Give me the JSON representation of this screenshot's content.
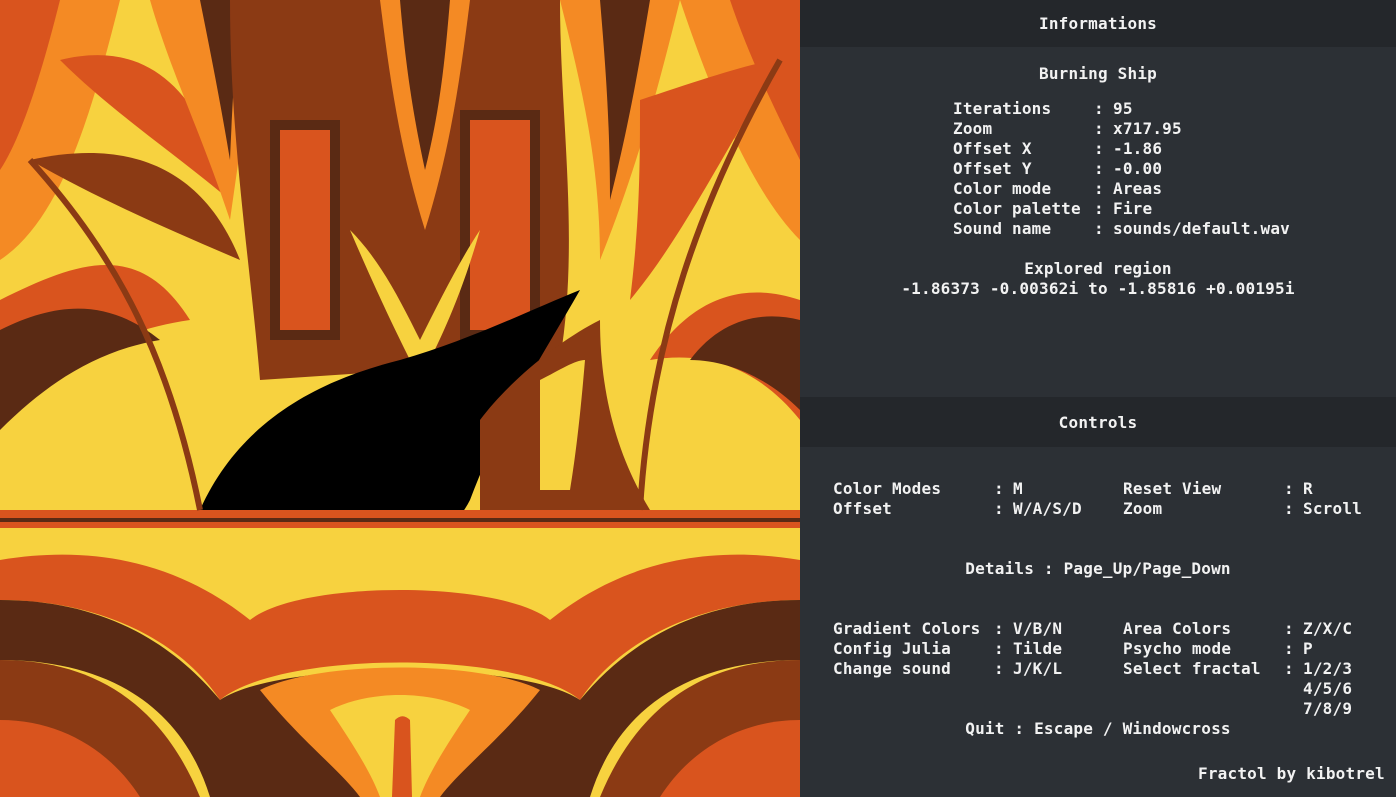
{
  "colors": {
    "panel_bg": "#2c3035",
    "band_bg": "#24272b",
    "text": "#f2f2f2",
    "fractal_palette": [
      "#000000",
      "#5a2a14",
      "#8b3a14",
      "#d9541e",
      "#f48a24",
      "#f7d23f"
    ]
  },
  "info": {
    "header": "Informations",
    "fractal_name": "Burning Ship",
    "fields": [
      {
        "label": "Iterations",
        "value": "95"
      },
      {
        "label": "Zoom",
        "value": "x717.95"
      },
      {
        "label": "Offset X",
        "value": "-1.86"
      },
      {
        "label": "Offset Y",
        "value": "-0.00"
      },
      {
        "label": "Color mode",
        "value": "Areas"
      },
      {
        "label": "Color palette",
        "value": "Fire"
      },
      {
        "label": "Sound name",
        "value": "sounds/default.wav"
      }
    ],
    "region_title": "Explored region",
    "region_value": "-1.86373 -0.00362i to -1.85816 +0.00195i"
  },
  "controls": {
    "header": "Controls",
    "group1": [
      {
        "label": "Color Modes",
        "key": "M"
      },
      {
        "label": "Reset View",
        "key": "R"
      },
      {
        "label": "Offset",
        "key": "W/A/S/D"
      },
      {
        "label": "Zoom",
        "key": "Scroll"
      }
    ],
    "details_label": "Details",
    "details_key": "Page_Up/Page_Down",
    "group2": [
      {
        "label": "Gradient Colors",
        "key": "V/B/N"
      },
      {
        "label": "Area Colors",
        "key": "Z/X/C"
      },
      {
        "label": "Config Julia",
        "key": "Tilde"
      },
      {
        "label": "Psycho mode",
        "key": "P"
      },
      {
        "label": "Change sound",
        "key": "J/K/L"
      },
      {
        "label": "Select fractal",
        "key": "1/2/3"
      }
    ],
    "select_more": [
      "4/5/6",
      "7/8/9"
    ],
    "quit_label": "Quit",
    "quit_key": "Escape / Windowcross"
  },
  "credit": "Fractol by kibotrel"
}
